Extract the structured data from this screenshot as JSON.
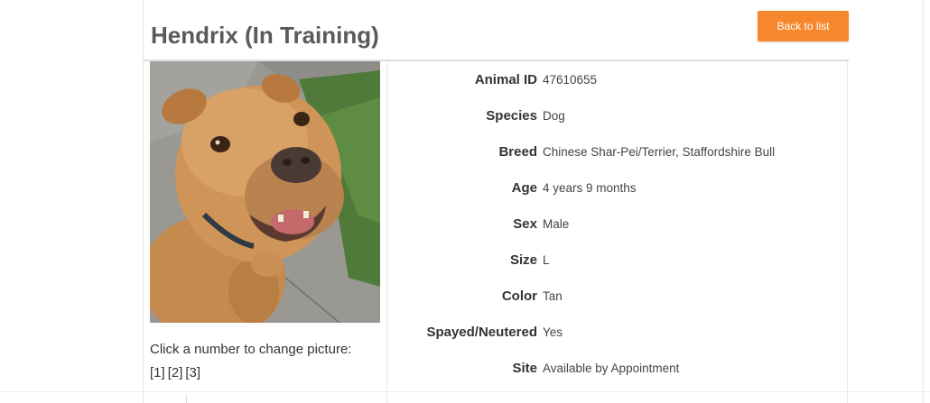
{
  "header": {
    "title": "Hendrix (In Training)",
    "back_label": "Back to list",
    "accent_color": "#f7872c"
  },
  "photo": {
    "subject": "tan dog",
    "caption": "Click a number to change picture:",
    "links": [
      "[1]",
      "[2]",
      "[3]"
    ]
  },
  "details": [
    {
      "label": "Animal ID",
      "value": "47610655"
    },
    {
      "label": "Species",
      "value": "Dog"
    },
    {
      "label": "Breed",
      "value": "Chinese Shar-Pei/Terrier, Staffordshire Bull"
    },
    {
      "label": "Age",
      "value": "4 years 9 months"
    },
    {
      "label": "Sex",
      "value": "Male"
    },
    {
      "label": "Size",
      "value": "L"
    },
    {
      "label": "Color",
      "value": "Tan"
    },
    {
      "label": "Spayed/Neutered",
      "value": "Yes"
    },
    {
      "label": "Site",
      "value": "Available by Appointment"
    }
  ]
}
